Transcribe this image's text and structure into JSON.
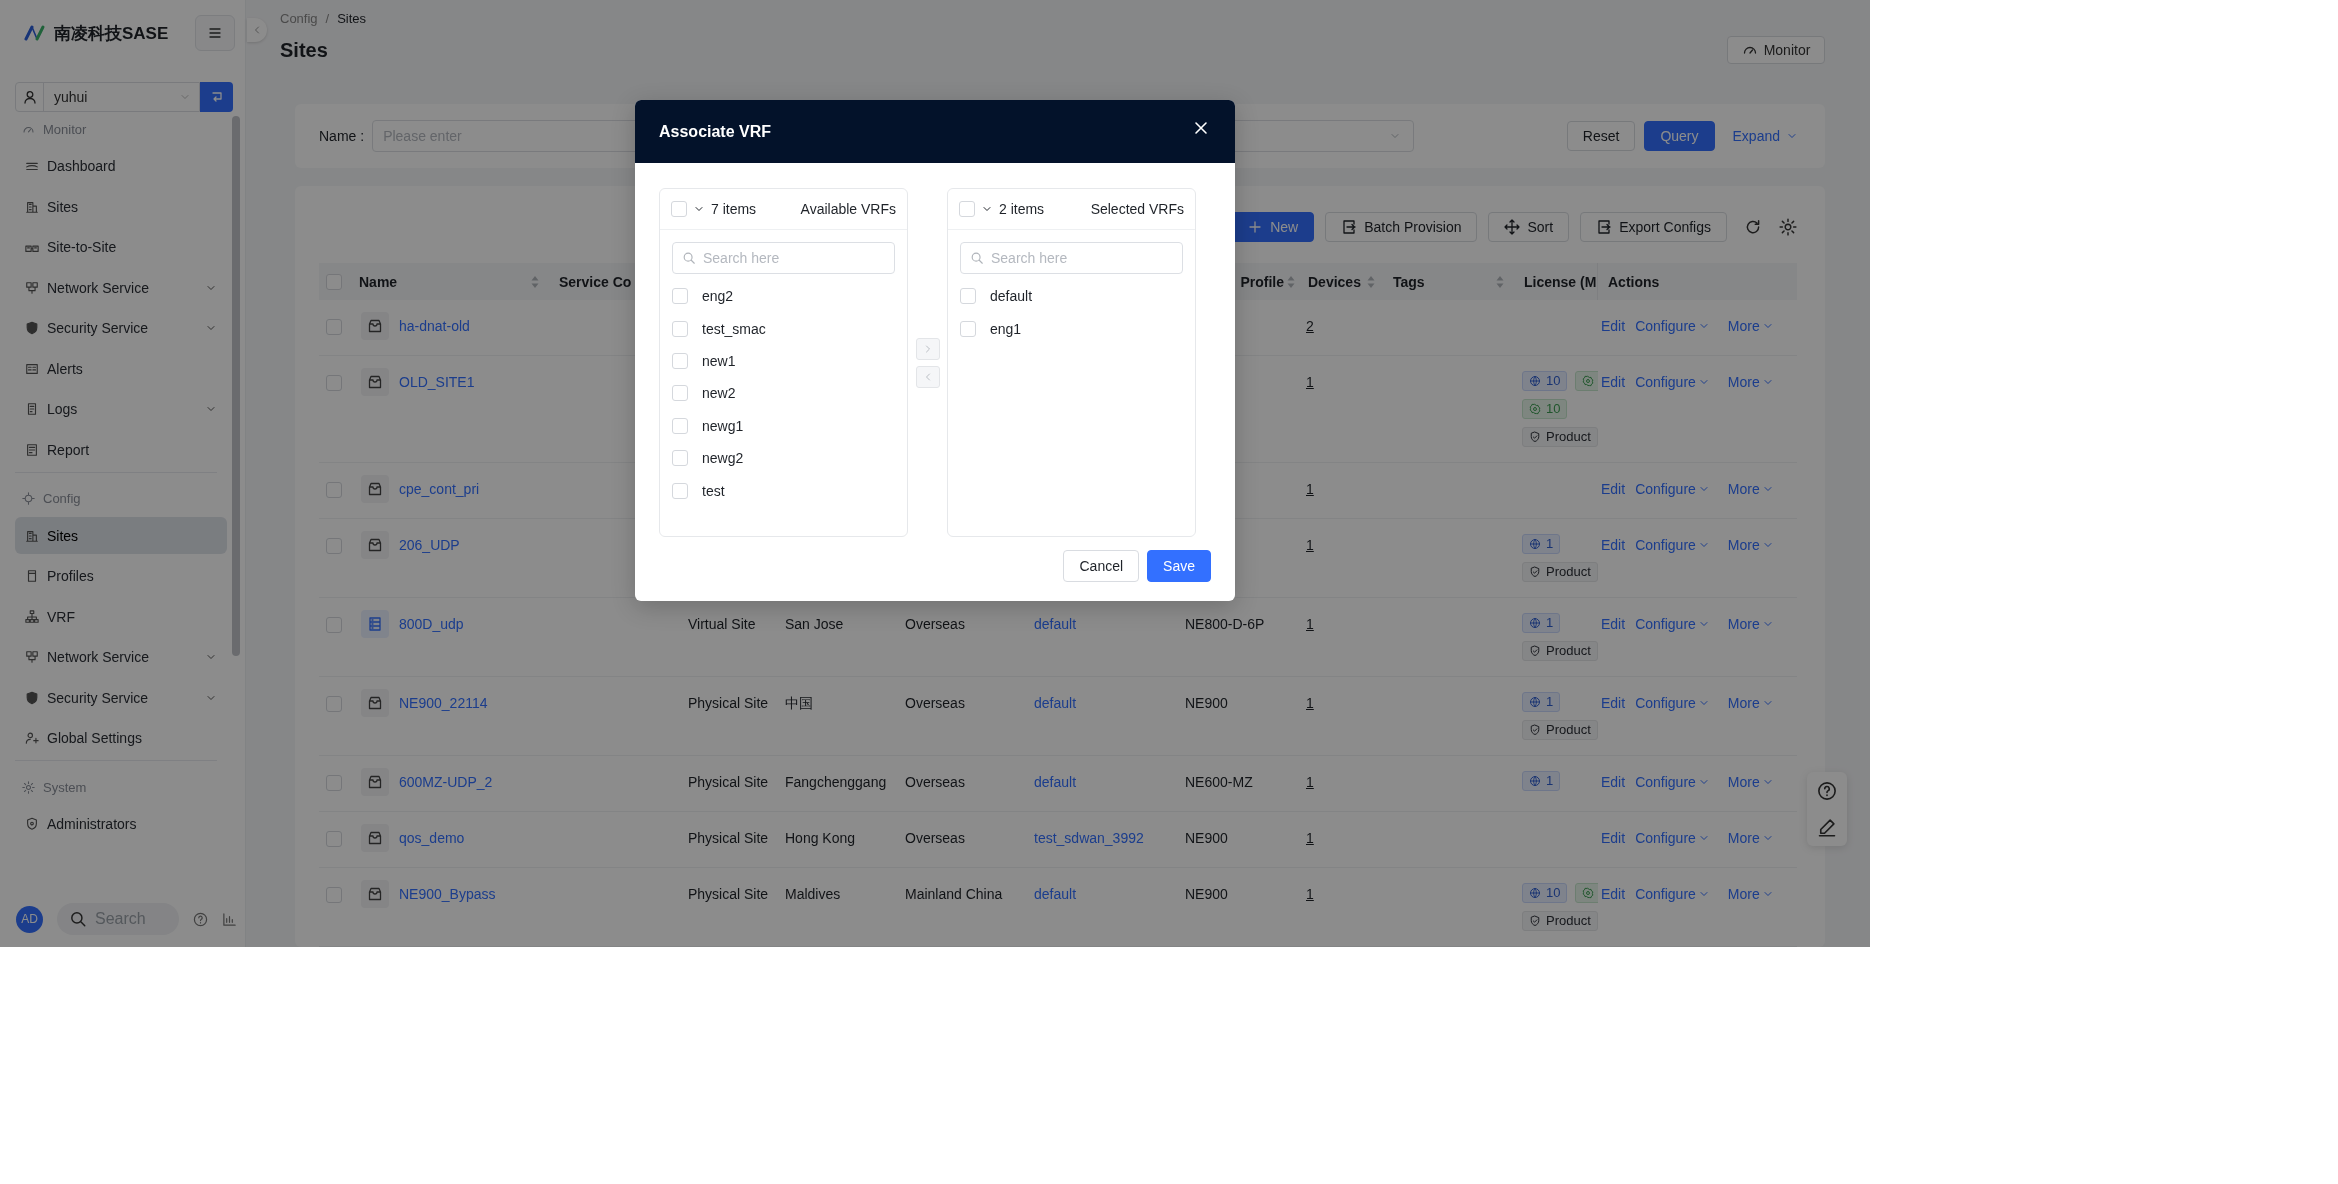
{
  "sidebar": {
    "logo_text": "南凌科技SASE",
    "user": "yuhui",
    "sections": [
      {
        "title": "Monitor",
        "items": [
          {
            "label": "Dashboard",
            "selected": false
          },
          {
            "label": "Sites",
            "selected": false
          },
          {
            "label": "Site-to-Site",
            "selected": false
          },
          {
            "label": "Network Service",
            "selected": false,
            "expanded": false
          },
          {
            "label": "Security Service",
            "selected": false,
            "expanded": false
          },
          {
            "label": "Alerts",
            "selected": false
          },
          {
            "label": "Logs",
            "selected": false,
            "expanded": false
          },
          {
            "label": "Report",
            "selected": false
          }
        ]
      },
      {
        "title": "Config",
        "items": [
          {
            "label": "Sites",
            "selected": true
          },
          {
            "label": "Profiles",
            "selected": false
          },
          {
            "label": "VRF",
            "selected": false
          },
          {
            "label": "Network Service",
            "selected": false,
            "expanded": false
          },
          {
            "label": "Security Service",
            "selected": false,
            "expanded": false
          },
          {
            "label": "Global Settings",
            "selected": false
          }
        ]
      },
      {
        "title": "System",
        "items": [
          {
            "label": "Administrators",
            "selected": false
          }
        ]
      }
    ],
    "avatar": "AD",
    "search_placeholder": "Search"
  },
  "breadcrumb": {
    "items": [
      "Config",
      "Sites"
    ],
    "separator": "/"
  },
  "page_title": "Sites",
  "monitor_button": "Monitor",
  "filter": {
    "name_label": "Name :",
    "name_placeholder": "Please enter",
    "reset": "Reset",
    "query": "Query",
    "expand": "Expand"
  },
  "toolbar": {
    "buttons": [
      {
        "label": "New",
        "kind": "primary"
      },
      {
        "label": "Batch Provision",
        "kind": "default"
      },
      {
        "label": "Sort",
        "kind": "default"
      },
      {
        "label": "Export Configs",
        "kind": "default"
      }
    ]
  },
  "table": {
    "select_all_checked": false,
    "header": {
      "name": {
        "label": "Name",
        "sortable": true
      },
      "column_3": {
        "label": "Service Co",
        "sortable": false
      },
      "profile": {
        "label": "Profile",
        "sortable": true
      },
      "devices": {
        "label": "Devices",
        "sortable": true
      },
      "tags": {
        "label": "Tags",
        "sortable": true
      },
      "license": {
        "label": "License (M"
      },
      "actions": {
        "label": "Actions",
        "sortable": false
      }
    },
    "rows": [
      {
        "checked": false,
        "kind": "physical",
        "name": "ha-dnat-old",
        "devices": "2",
        "actions": [
          {
            "label": "Edit",
            "menu": false
          },
          {
            "label": "Configure",
            "menu": true
          },
          {
            "label": "More",
            "menu": true
          }
        ]
      },
      {
        "checked": false,
        "kind": "physical",
        "name": "OLD_SITE1",
        "devices": "1",
        "licenses": [
          [
            {
              "kind": "globe",
              "text": "10"
            },
            {
              "kind": "ring"
            }
          ],
          [
            {
              "kind": "ring",
              "text": "10"
            }
          ],
          [
            {
              "kind": "product",
              "text": "Product"
            }
          ]
        ],
        "actions": [
          {
            "label": "Edit",
            "menu": false
          },
          {
            "label": "Configure",
            "menu": true
          },
          {
            "label": "More",
            "menu": true
          }
        ]
      },
      {
        "checked": false,
        "kind": "physical",
        "name": "cpe_cont_pri",
        "devices": "1",
        "actions": [
          {
            "label": "Edit",
            "menu": false
          },
          {
            "label": "Configure",
            "menu": true
          },
          {
            "label": "More",
            "menu": true
          }
        ]
      },
      {
        "checked": false,
        "kind": "physical",
        "name": "206_UDP",
        "devices": "1",
        "licenses": [
          [
            {
              "kind": "globe",
              "text": "1"
            }
          ],
          [
            {
              "kind": "product",
              "text": "Product"
            }
          ]
        ],
        "actions": [
          {
            "label": "Edit",
            "menu": false
          },
          {
            "label": "Configure",
            "menu": true
          },
          {
            "label": "More",
            "menu": true
          }
        ]
      },
      {
        "checked": false,
        "kind": "virtual",
        "name": "800D_udp",
        "column_4": "Virtual Site",
        "column_5": "San Jose",
        "column_6": "Overseas",
        "column_7": "default",
        "profile": "NE800-D-6P",
        "devices": "1",
        "licenses": [
          [
            {
              "kind": "globe",
              "text": "1"
            }
          ],
          [
            {
              "kind": "product",
              "text": "Product"
            }
          ]
        ],
        "actions": [
          {
            "label": "Edit",
            "menu": false
          },
          {
            "label": "Configure",
            "menu": true
          },
          {
            "label": "More",
            "menu": true
          }
        ]
      },
      {
        "checked": false,
        "kind": "physical",
        "name": "NE900_22114",
        "column_4": "Physical Site",
        "column_5": "中国",
        "column_6": "Overseas",
        "column_7": "default",
        "profile": "NE900",
        "devices": "1",
        "licenses": [
          [
            {
              "kind": "globe",
              "text": "1"
            }
          ],
          [
            {
              "kind": "product",
              "text": "Product"
            }
          ]
        ],
        "actions": [
          {
            "label": "Edit",
            "menu": false
          },
          {
            "label": "Configure",
            "menu": true
          },
          {
            "label": "More",
            "menu": true
          }
        ]
      },
      {
        "checked": false,
        "kind": "physical",
        "name": "600MZ-UDP_2",
        "column_4": "Physical Site",
        "column_5": "Fangchenggang",
        "column_6": "Overseas",
        "column_7": "default",
        "profile": "NE600-MZ",
        "devices": "1",
        "licenses": [
          [
            {
              "kind": "globe",
              "text": "1"
            }
          ]
        ],
        "actions": [
          {
            "label": "Edit",
            "menu": false
          },
          {
            "label": "Configure",
            "menu": true
          },
          {
            "label": "More",
            "menu": true
          }
        ]
      },
      {
        "checked": false,
        "kind": "physical",
        "name": "qos_demo",
        "column_4": "Physical Site",
        "column_5": "Hong Kong",
        "column_6": "Overseas",
        "column_7": "test_sdwan_3992",
        "profile": "NE900",
        "devices": "1",
        "actions": [
          {
            "label": "Edit",
            "menu": false
          },
          {
            "label": "Configure",
            "menu": true
          },
          {
            "label": "More",
            "menu": true
          }
        ]
      },
      {
        "checked": false,
        "kind": "physical",
        "name": "NE900_Bypass",
        "column_4": "Physical Site",
        "column_5": "Maldives",
        "column_6": "Mainland China",
        "column_7": "default",
        "profile": "NE900",
        "devices": "1",
        "licenses": [
          [
            {
              "kind": "globe",
              "text": "10"
            },
            {
              "kind": "ring"
            }
          ],
          [
            {
              "kind": "product",
              "text": "Product"
            }
          ]
        ],
        "actions": [
          {
            "label": "Edit",
            "menu": false
          },
          {
            "label": "Configure",
            "menu": true
          },
          {
            "label": "More",
            "menu": true
          }
        ]
      }
    ]
  },
  "modal": {
    "title": "Associate VRF",
    "lists": [
      {
        "all_checked": false,
        "count": "7 items",
        "title": "Available VRFs",
        "search_placeholder": "Search here",
        "items": [
          {
            "label": "eng2",
            "checked": false
          },
          {
            "label": "test_smac",
            "checked": false
          },
          {
            "label": "new1",
            "checked": false
          },
          {
            "label": "new2",
            "checked": false
          },
          {
            "label": "newg1",
            "checked": false
          },
          {
            "label": "newg2",
            "checked": false
          },
          {
            "label": "test",
            "checked": false
          }
        ]
      },
      {
        "all_checked": false,
        "count": "2 items",
        "title": "Selected VRFs",
        "search_placeholder": "Search here",
        "items": [
          {
            "label": "default",
            "checked": false
          },
          {
            "label": "eng1",
            "checked": false
          }
        ]
      }
    ],
    "move_buttons": [
      {
        "disabled": true
      },
      {
        "disabled": true
      }
    ],
    "cancel": "Cancel",
    "save": "Save"
  }
}
